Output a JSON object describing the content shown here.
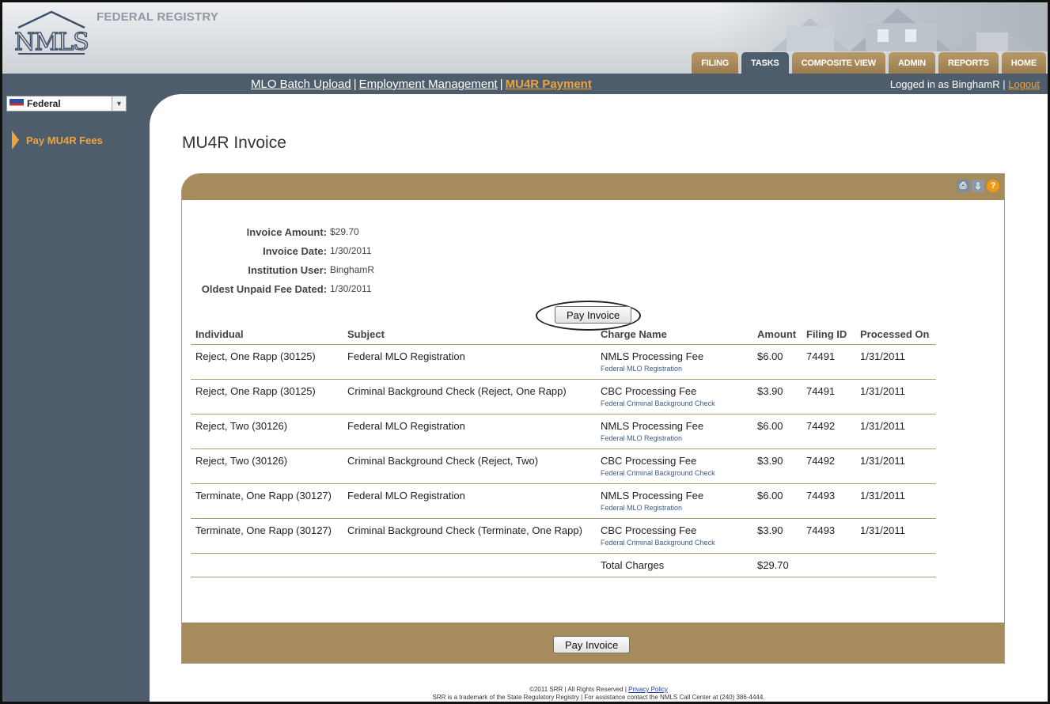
{
  "header": {
    "logo_text": "NMLS",
    "registry_title": "FEDERAL REGISTRY",
    "tabs": [
      {
        "label": "FILING",
        "active": false
      },
      {
        "label": "TASKS",
        "active": true
      },
      {
        "label": "COMPOSITE VIEW",
        "active": false
      },
      {
        "label": "ADMIN",
        "active": false
      },
      {
        "label": "REPORTS",
        "active": false
      },
      {
        "label": "HOME",
        "active": false
      }
    ]
  },
  "subnav": {
    "links": [
      "MLO Batch Upload",
      "Employment Management",
      "MU4R Payment"
    ],
    "separator": "|",
    "login_text": "Logged in as BinghamR",
    "logout": "Logout"
  },
  "sidebar": {
    "select_value": "Federal",
    "items": [
      "Pay MU4R Fees"
    ]
  },
  "main": {
    "title": "MU4R Invoice",
    "info": [
      {
        "label": "Invoice Amount:",
        "value": "$29.70"
      },
      {
        "label": "Invoice Date:",
        "value": "1/30/2011"
      },
      {
        "label": "Institution User:",
        "value": "BinghamR"
      },
      {
        "label": "Oldest Unpaid Fee Dated:",
        "value": "1/30/2011"
      }
    ],
    "pay_button": "Pay Invoice",
    "table": {
      "headers": [
        "Individual",
        "Subject",
        "Charge Name",
        "Amount",
        "Filing ID",
        "Processed On"
      ],
      "rows": [
        {
          "individual": "Reject, One Rapp (30125)",
          "subject": "Federal MLO Registration",
          "charge": "NMLS Processing Fee",
          "charge_sub": "Federal MLO Registration",
          "amount": "$6.00",
          "filing_id": "74491",
          "processed": "1/31/2011"
        },
        {
          "individual": "Reject, One Rapp (30125)",
          "subject": "Criminal Background Check (Reject, One Rapp)",
          "charge": "CBC Processing Fee",
          "charge_sub": "Federal Criminal Background Check",
          "amount": "$3.90",
          "filing_id": "74491",
          "processed": "1/31/2011"
        },
        {
          "individual": "Reject, Two (30126)",
          "subject": "Federal MLO Registration",
          "charge": "NMLS Processing Fee",
          "charge_sub": "Federal MLO Registration",
          "amount": "$6.00",
          "filing_id": "74492",
          "processed": "1/31/2011"
        },
        {
          "individual": "Reject, Two (30126)",
          "subject": "Criminal Background Check (Reject, Two)",
          "charge": "CBC Processing Fee",
          "charge_sub": "Federal Criminal Background Check",
          "amount": "$3.90",
          "filing_id": "74492",
          "processed": "1/31/2011"
        },
        {
          "individual": "Terminate, One Rapp (30127)",
          "subject": "Federal MLO Registration",
          "charge": "NMLS Processing Fee",
          "charge_sub": "Federal MLO Registration",
          "amount": "$6.00",
          "filing_id": "74493",
          "processed": "1/31/2011"
        },
        {
          "individual": "Terminate, One Rapp (30127)",
          "subject": "Criminal Background Check (Terminate, One Rapp)",
          "charge": "CBC Processing Fee",
          "charge_sub": "Federal Criminal Background Check",
          "amount": "$3.90",
          "filing_id": "74493",
          "processed": "1/31/2011"
        }
      ],
      "total_label": "Total Charges",
      "total_amount": "$29.70"
    },
    "icons": [
      "printer-icon",
      "export-icon",
      "help-icon"
    ]
  },
  "footer": {
    "copyright": "©2011 SRR | All Rights Reserved |",
    "privacy": "Privacy Policy",
    "line2": "SRR is a trademark of the State Regulatory Registry | For assistance contact the NMLS Call Center at (240) 386-4444."
  },
  "colors": {
    "nav_bg": "#4e5d6b",
    "accent_orange": "#f0a43c",
    "panel_tan": "#a68b5c",
    "tab_tan": "#9a7b4d"
  }
}
